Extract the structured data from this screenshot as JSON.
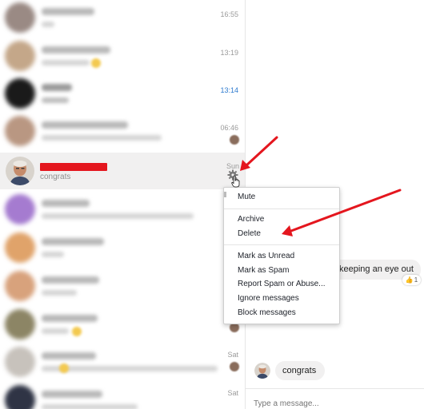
{
  "conversations": [
    {
      "time": "16:55",
      "time_color": "gray"
    },
    {
      "time": "13:19",
      "time_color": "gray"
    },
    {
      "time": "13:14",
      "time_color": "blue"
    },
    {
      "time": "06:46",
      "time_color": "gray"
    },
    {
      "time": "Sun",
      "snippet": "congrats",
      "active": true
    },
    {
      "time": ""
    },
    {
      "time": ""
    },
    {
      "time": ""
    },
    {
      "time": ""
    },
    {
      "time": "Sat"
    },
    {
      "time": "Sat"
    }
  ],
  "context_menu": {
    "items": [
      "Mute",
      "Archive",
      "Delete",
      "Mark as Unread",
      "Mark as Spam",
      "Report Spam or Abuse...",
      "Ignore messages",
      "Block messages"
    ]
  },
  "chat": {
    "incoming_text": "keeping an eye out",
    "reaction_count": "1",
    "outgoing_text": "congrats",
    "composer_placeholder": "Type a message..."
  },
  "colors": {
    "annotation_red": "#e4161e",
    "timestamp_blue": "#2e7bcf",
    "active_row_bg": "#f1f0f0"
  }
}
